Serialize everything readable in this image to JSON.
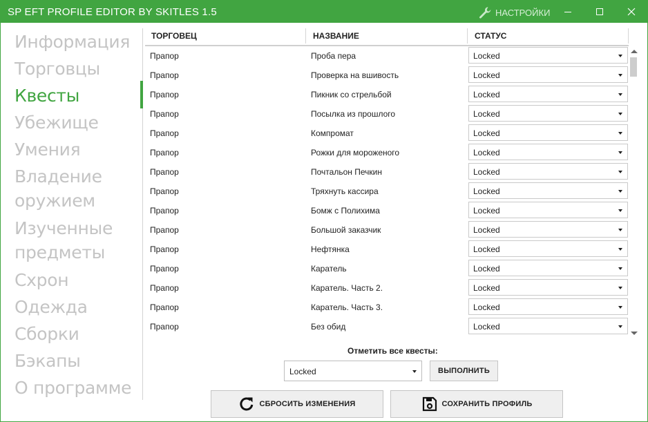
{
  "window": {
    "title": "SP EFT PROFILE EDITOR BY SKITLES 1.5",
    "settings_label": "НАСТРОЙКИ",
    "settings_icon": "wrench-icon",
    "accent_color": "#41a541",
    "controls": [
      "minimize-icon",
      "maximize-icon",
      "close-icon"
    ]
  },
  "sidebar": {
    "items": [
      {
        "label": "Информация"
      },
      {
        "label": "Торговцы"
      },
      {
        "label": "Квесты",
        "active": true
      },
      {
        "label": "Убежище"
      },
      {
        "label": "Умения"
      },
      {
        "label": "Владение"
      },
      {
        "label": "оружием"
      },
      {
        "label": "Изученные"
      },
      {
        "label": "предметы"
      },
      {
        "label": "Схрон"
      },
      {
        "label": "Одежда"
      },
      {
        "label": "Сборки"
      },
      {
        "label": "Бэкапы"
      },
      {
        "label": "О программе"
      }
    ]
  },
  "table": {
    "columns": [
      "ТОРГОВЕЦ",
      "НАЗВАНИЕ",
      "СТАТУС"
    ],
    "rows": [
      {
        "trader": "Прапор",
        "name": "Проба пера",
        "status": "Locked"
      },
      {
        "trader": "Прапор",
        "name": "Проверка на вшивость",
        "status": "Locked"
      },
      {
        "trader": "Прапор",
        "name": "Пикник со стрельбой",
        "status": "Locked"
      },
      {
        "trader": "Прапор",
        "name": "Посылка из прошлого",
        "status": "Locked"
      },
      {
        "trader": "Прапор",
        "name": "Компромат",
        "status": "Locked"
      },
      {
        "trader": "Прапор",
        "name": "Рожки для мороженого",
        "status": "Locked"
      },
      {
        "trader": "Прапор",
        "name": "Почтальон Печкин",
        "status": "Locked"
      },
      {
        "trader": "Прапор",
        "name": "Тряхнуть кассира",
        "status": "Locked"
      },
      {
        "trader": "Прапор",
        "name": "Бомж с Полихима",
        "status": "Locked"
      },
      {
        "trader": "Прапор",
        "name": "Большой заказчик",
        "status": "Locked"
      },
      {
        "trader": "Прапор",
        "name": "Нефтянка",
        "status": "Locked"
      },
      {
        "trader": "Прапор",
        "name": "Каратель",
        "status": "Locked"
      },
      {
        "trader": "Прапор",
        "name": "Каратель. Часть 2.",
        "status": "Locked"
      },
      {
        "trader": "Прапор",
        "name": "Каратель. Часть 3.",
        "status": "Locked"
      },
      {
        "trader": "Прапор",
        "name": "Без обид",
        "status": "Locked"
      },
      {
        "trader": "",
        "name": "",
        "status": ""
      }
    ]
  },
  "bulk": {
    "label": "Отметить все квесты:",
    "selected": "Locked",
    "execute_label": "ВЫПОЛНИТЬ"
  },
  "actions": {
    "reset_label": "СБРОСИТЬ ИЗМЕНЕНИЯ",
    "reset_icon": "undo-icon",
    "save_label": "СОХРАНИТЬ ПРОФИЛЬ",
    "save_icon": "floppy-disk-icon"
  }
}
